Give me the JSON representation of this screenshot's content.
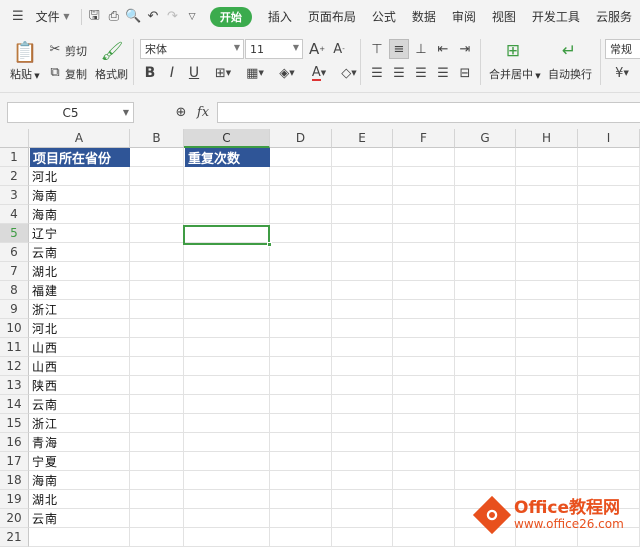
{
  "menubar": {
    "file_label": "文件",
    "tabs": [
      "开始",
      "插入",
      "页面布局",
      "公式",
      "数据",
      "审阅",
      "视图",
      "开发工具",
      "云服务"
    ],
    "active_tab": "开始"
  },
  "ribbon": {
    "paste": "粘贴",
    "cut": "剪切",
    "copy": "复制",
    "format_painter": "格式刷",
    "font_name": "宋体",
    "font_size": "11",
    "merge_center": "合并居中",
    "wrap_text": "自动换行",
    "number_format": "常规",
    "bold": "B",
    "italic": "I",
    "underline": "U"
  },
  "formula_bar": {
    "cell_ref": "C5",
    "fx_label": "fx",
    "value": ""
  },
  "sheet": {
    "columns": [
      "A",
      "B",
      "C",
      "D",
      "E",
      "F",
      "G",
      "H",
      "I"
    ],
    "rows": [
      "1",
      "2",
      "3",
      "4",
      "5",
      "6",
      "7",
      "8",
      "9",
      "10",
      "11",
      "12",
      "13",
      "14",
      "15",
      "16",
      "17",
      "18",
      "19",
      "20",
      "21"
    ],
    "header_a1": "项目所在省份",
    "header_c1": "重复次数",
    "col_a_values": [
      "河北",
      "海南",
      "海南",
      "辽宁",
      "云南",
      "湖北",
      "福建",
      "浙江",
      "河北",
      "山西",
      "山西",
      "陕西",
      "云南",
      "浙江",
      "青海",
      "宁夏",
      "海南",
      "湖北",
      "云南"
    ],
    "selected_cell": "C5"
  },
  "watermark": {
    "brand": "Office教程网",
    "url": "www.office26.com"
  }
}
